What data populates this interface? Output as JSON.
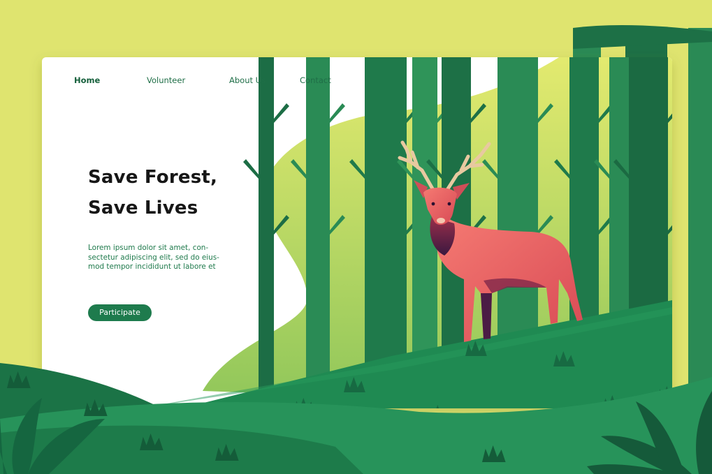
{
  "nav": {
    "items": [
      {
        "label": "Home",
        "active": true
      },
      {
        "label": "Volunteer",
        "active": false
      },
      {
        "label": "About Us",
        "active": false
      },
      {
        "label": "Contact",
        "active": false
      }
    ]
  },
  "hero": {
    "title_lines": [
      "Save Forest,",
      "Save Lives"
    ],
    "body_lines": [
      "Lorem ipsum dolor sit amet, con-",
      "sectetur adipiscing elit, sed do eius-",
      "mod tempor incididunt ut labore et"
    ],
    "cta_label": "Participate"
  },
  "colors": {
    "background": "#dfe46f",
    "card": "#ffffff",
    "brand_green": "#1e7b4d",
    "forest_dark": "#1f7448",
    "forest_light": "#c9de7a",
    "hill": "#1f8a52",
    "deer": "#e8605e",
    "antler": "#e8c9a0"
  },
  "illustration": {
    "subject": "deer-in-forest",
    "icon_names": [
      "deer-illustration",
      "tree-icon",
      "grass-icon",
      "leaf-icon"
    ]
  }
}
